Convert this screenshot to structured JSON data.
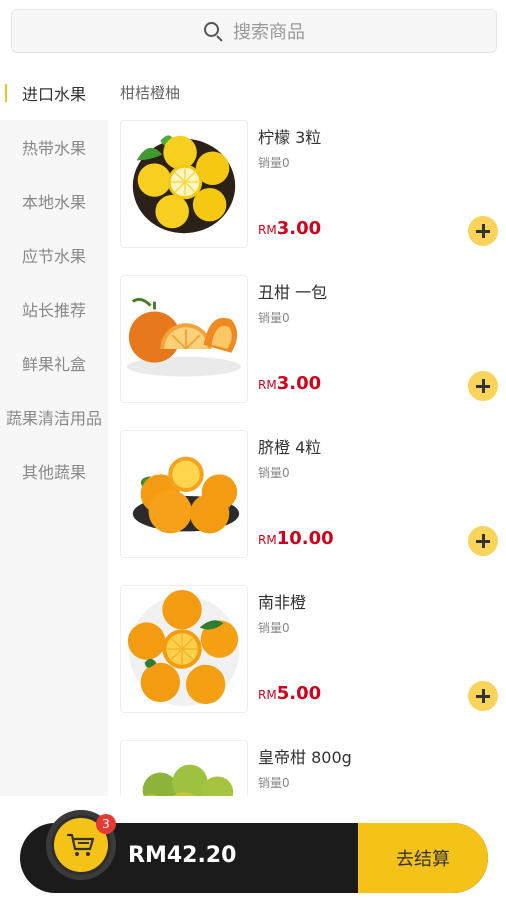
{
  "search": {
    "placeholder": "搜索商品"
  },
  "sidebar": {
    "items": [
      {
        "label": "进口水果",
        "active": true
      },
      {
        "label": "热带水果"
      },
      {
        "label": "本地水果"
      },
      {
        "label": "应节水果"
      },
      {
        "label": "站长推荐"
      },
      {
        "label": "鲜果礼盒"
      },
      {
        "label": "蔬果清洁用品"
      },
      {
        "label": "其他蔬果"
      }
    ]
  },
  "category": {
    "title": "柑桔橙柚"
  },
  "products": [
    {
      "name": "柠檬 3粒",
      "sales": "销量0",
      "currency": "RM",
      "price": "3.00",
      "image_icon": "lemon-image"
    },
    {
      "name": "丑柑 一包",
      "sales": "销量0",
      "currency": "RM",
      "price": "3.00",
      "image_icon": "ugli-fruit-image"
    },
    {
      "name": "脐橙 4粒",
      "sales": "销量0",
      "currency": "RM",
      "price": "10.00",
      "image_icon": "navel-orange-image"
    },
    {
      "name": "南非橙",
      "sales": "销量0",
      "currency": "RM",
      "price": "5.00",
      "image_icon": "orange-image"
    },
    {
      "name": "皇帝柑 800g",
      "sales": "销量0",
      "currency": "",
      "price": "",
      "image_icon": "mandarin-image"
    }
  ],
  "cart": {
    "count": "3",
    "total": "RM42.20",
    "checkout_label": "去结算",
    "icon": "cart-icon"
  },
  "colors": {
    "accent": "#f5c318",
    "price": "#d0021b",
    "bar": "#1b1b1b",
    "badge": "#e53935"
  }
}
